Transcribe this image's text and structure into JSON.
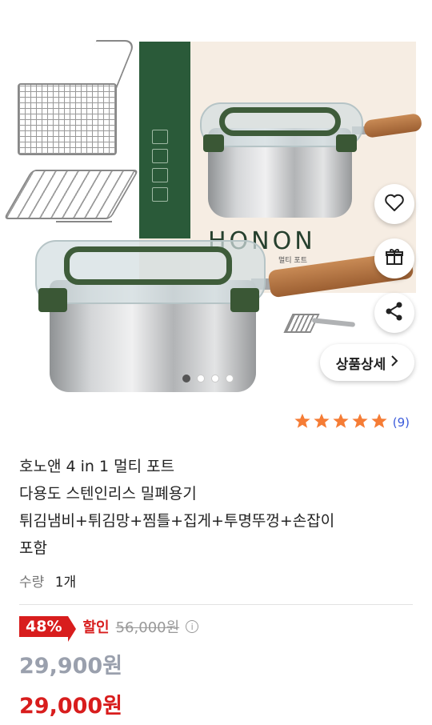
{
  "hero": {
    "brand_text": "HONON",
    "brand_sub": "멀티 포트",
    "carousel": {
      "total": 4,
      "active": 0
    },
    "detail_button_label": "상품상세",
    "icons": {
      "wishlist": "heart-icon",
      "gift": "gift-icon",
      "share": "share-icon",
      "chevron": "chevron-right-icon"
    }
  },
  "rating": {
    "stars": 5,
    "count_text": "(9)",
    "star_color": "#f57c35"
  },
  "product": {
    "title_lines": [
      "호노앤 4 in 1 멀티 포트",
      "다용도 스텐인리스 밀폐용기",
      "튀김냄비+튀김망+찜틀+집게+투명뚜껑+손잡이",
      "포함"
    ]
  },
  "quantity": {
    "label": "수량",
    "value": "1개"
  },
  "pricing": {
    "discount_badge": "48%",
    "discount_label": "할인",
    "original_price": "56,000원",
    "info_symbol": "i",
    "price": "29,900원",
    "final_price": "29,000원",
    "accent_color": "#d81d1d"
  }
}
